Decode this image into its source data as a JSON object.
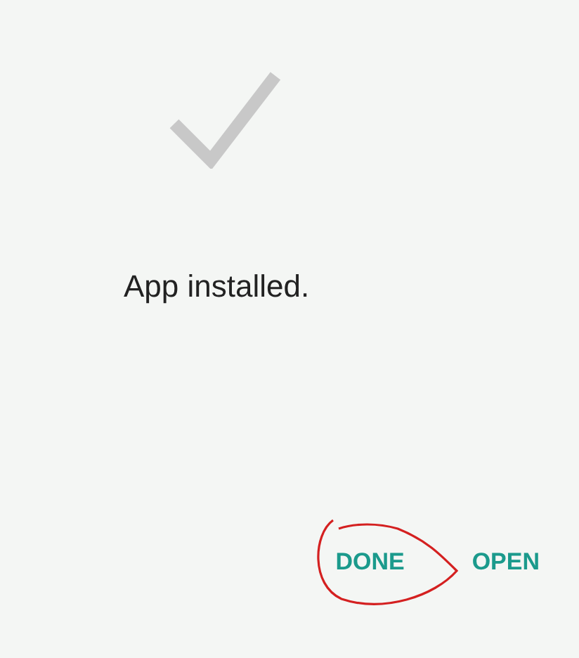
{
  "message": "App installed.",
  "buttons": [
    {
      "label": "DONE",
      "circled": true
    },
    {
      "label": "OPEN",
      "circled": false
    }
  ]
}
